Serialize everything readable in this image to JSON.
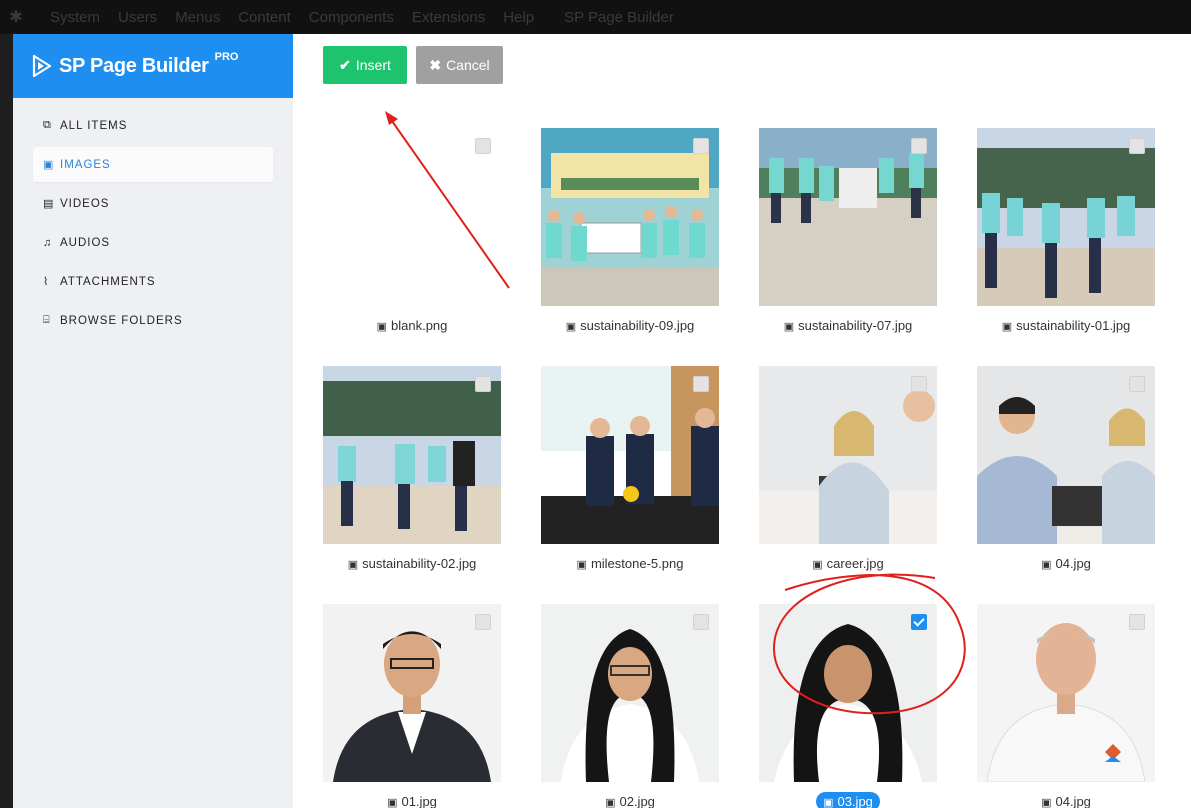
{
  "topbar": {
    "items": [
      "System",
      "Users",
      "Menus",
      "Content",
      "Components",
      "Extensions",
      "Help"
    ],
    "brand": "SP Page Builder"
  },
  "sidebar": {
    "brand_name": "SP Page Builder",
    "brand_badge": "PRO",
    "items": [
      {
        "label": "ALL ITEMS",
        "icon": "copy-icon",
        "glyph": "⧉",
        "active": false
      },
      {
        "label": "IMAGES",
        "icon": "image-icon",
        "glyph": "▣",
        "active": true
      },
      {
        "label": "VIDEOS",
        "icon": "film-icon",
        "glyph": "▤",
        "active": false
      },
      {
        "label": "AUDIOS",
        "icon": "music-icon",
        "glyph": "♫",
        "active": false
      },
      {
        "label": "ATTACHMENTS",
        "icon": "paperclip-icon",
        "glyph": "⌇",
        "active": false
      },
      {
        "label": "BROWSE FOLDERS",
        "icon": "folder-open-icon",
        "glyph": "⌸",
        "active": false
      }
    ]
  },
  "toolbar": {
    "insert_label": "Insert",
    "cancel_label": "Cancel"
  },
  "media": [
    {
      "name": "blank.png",
      "checked": false
    },
    {
      "name": "sustainability-09.jpg",
      "checked": false
    },
    {
      "name": "sustainability-07.jpg",
      "checked": false
    },
    {
      "name": "sustainability-01.jpg",
      "checked": false
    },
    {
      "name": "sustainability-02.jpg",
      "checked": false
    },
    {
      "name": "milestone-5.png",
      "checked": false
    },
    {
      "name": "career.jpg",
      "checked": false
    },
    {
      "name": "04.jpg",
      "checked": false
    },
    {
      "name": "01.jpg",
      "checked": false
    },
    {
      "name": "02.jpg",
      "checked": false
    },
    {
      "name": "03.jpg",
      "checked": true
    },
    {
      "name": "04.jpg",
      "checked": false
    }
  ],
  "colors": {
    "accent": "#1f8ef1",
    "insert": "#1ec46d",
    "cancel": "#a0a0a0",
    "annotation": "#e0201c"
  }
}
